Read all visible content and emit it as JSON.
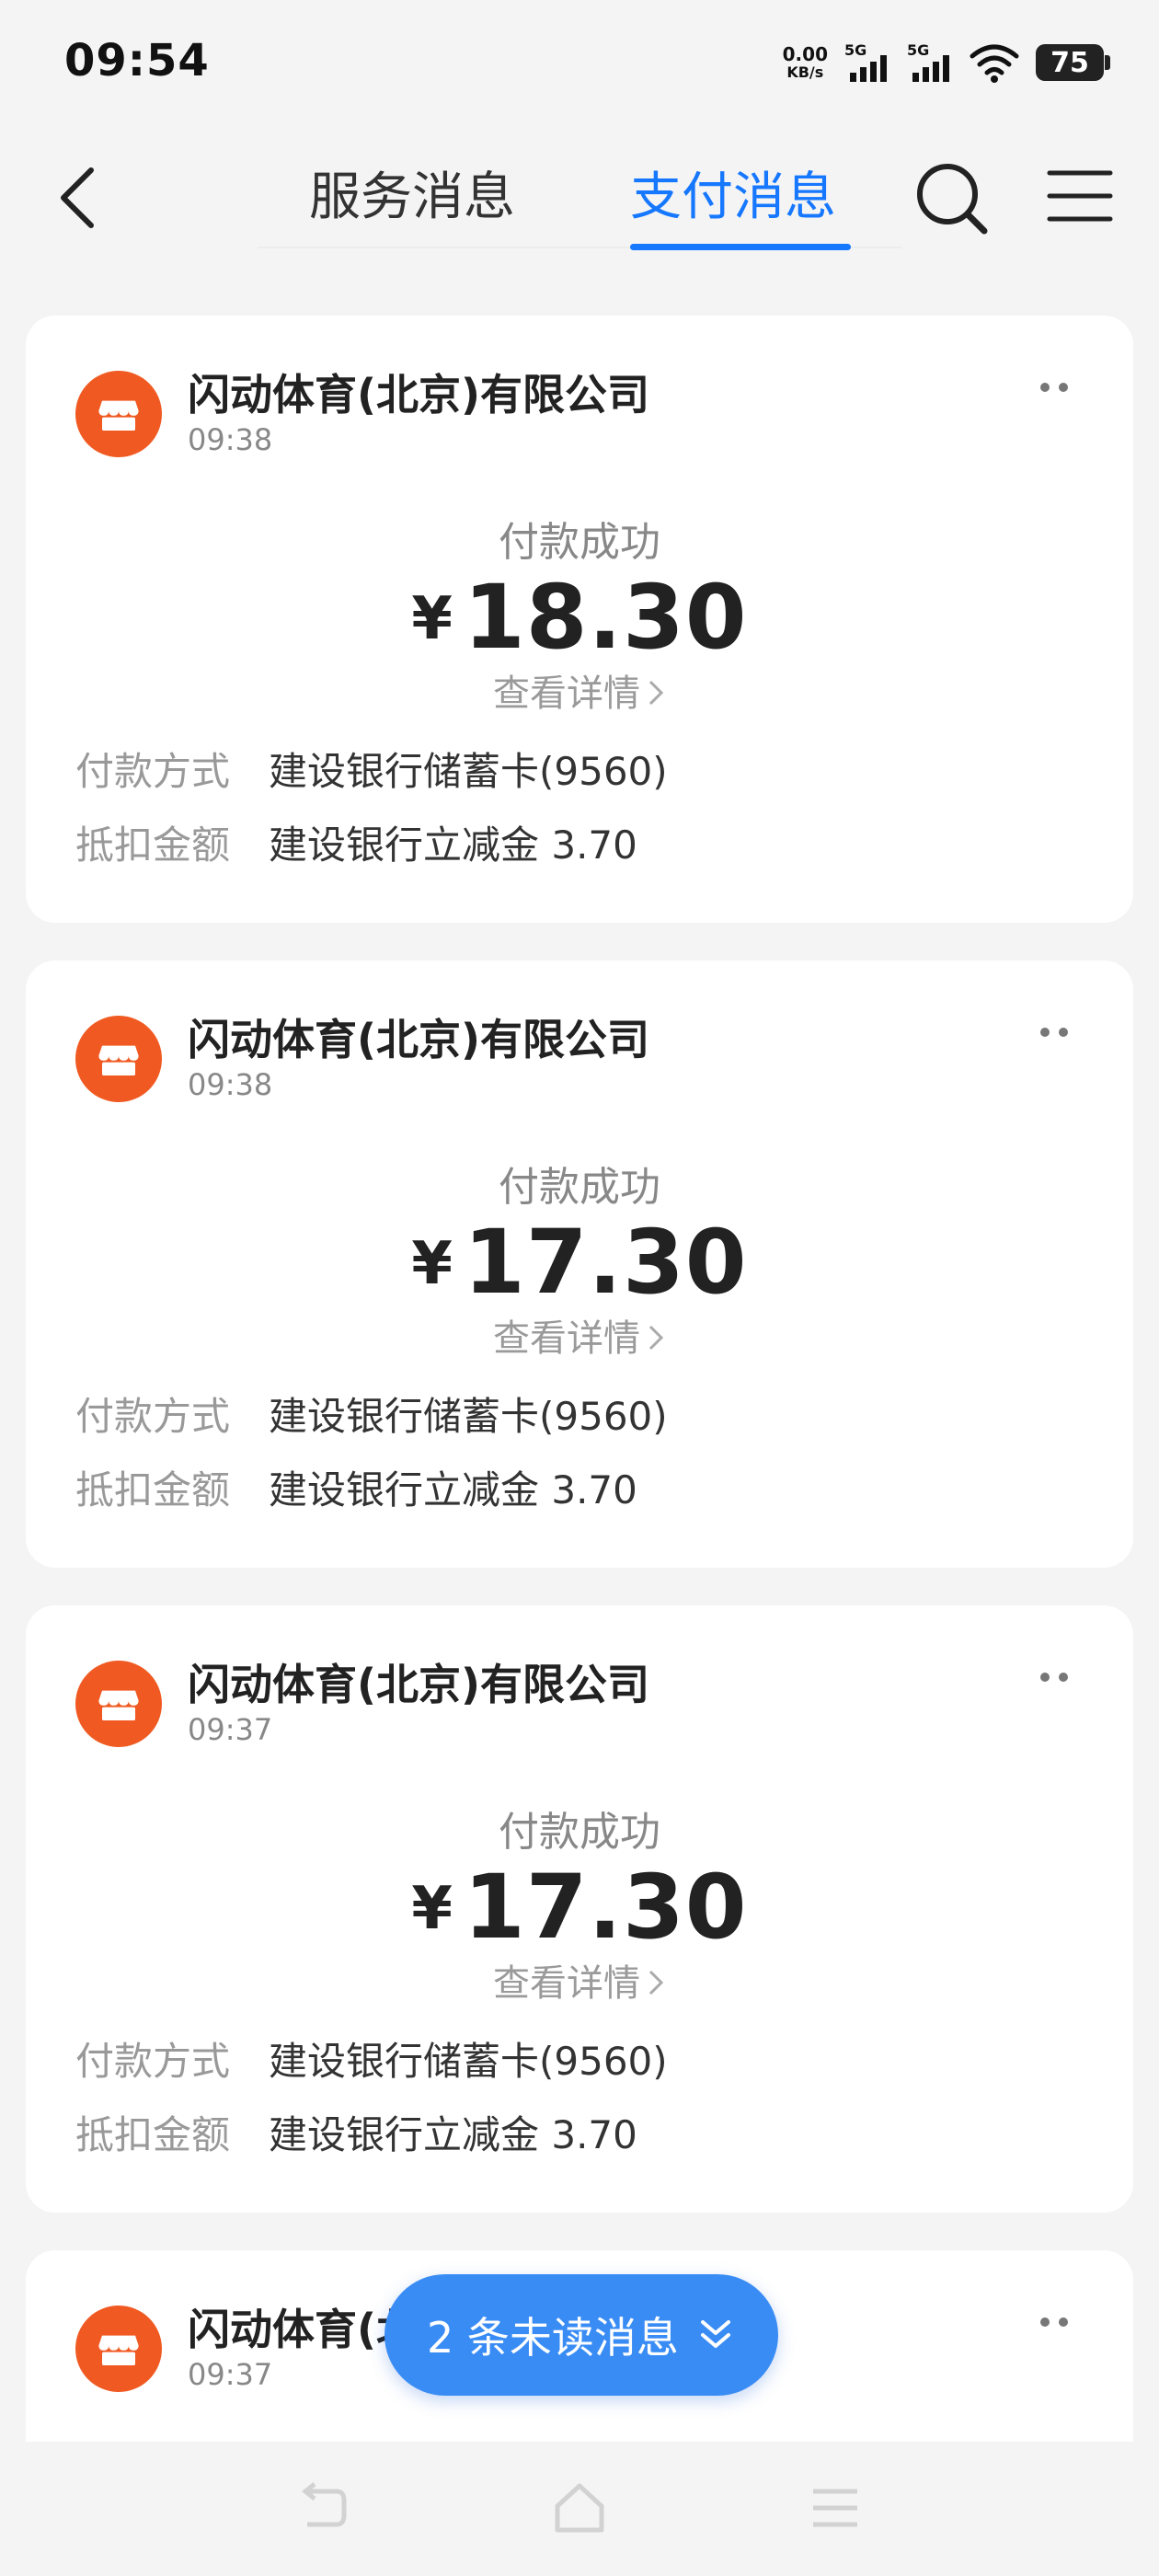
{
  "status_bar": {
    "time": "09:54",
    "net_speed_value": "0.00",
    "net_speed_unit": "KB/s",
    "signal_1": "5G",
    "signal_2": "5G",
    "battery": "75"
  },
  "nav": {
    "tabs": [
      {
        "label": "服务消息",
        "active": false
      },
      {
        "label": "支付消息",
        "active": true
      }
    ],
    "icons": [
      "back-icon",
      "search-icon",
      "menu-icon"
    ],
    "accent_color": "#1677ff"
  },
  "messages": [
    {
      "merchant": "闪动体育(北京)有限公司",
      "time": "09:38",
      "status": "付款成功",
      "currency": "¥",
      "amount": "18.30",
      "detail_label": "查看详情",
      "method_label": "付款方式",
      "method_value": "建设银行储蓄卡(9560)",
      "discount_label": "抵扣金额",
      "discount_value": "建设银行立减金 3.70"
    },
    {
      "merchant": "闪动体育(北京)有限公司",
      "time": "09:38",
      "status": "付款成功",
      "currency": "¥",
      "amount": "17.30",
      "detail_label": "查看详情",
      "method_label": "付款方式",
      "method_value": "建设银行储蓄卡(9560)",
      "discount_label": "抵扣金额",
      "discount_value": "建设银行立减金 3.70"
    },
    {
      "merchant": "闪动体育(北京)有限公司",
      "time": "09:37",
      "status": "付款成功",
      "currency": "¥",
      "amount": "17.30",
      "detail_label": "查看详情",
      "method_label": "付款方式",
      "method_value": "建设银行储蓄卡(9560)",
      "discount_label": "抵扣金额",
      "discount_value": "建设银行立减金 3.70"
    },
    {
      "merchant": "闪动体育(北京)有限公司",
      "time": "09:37"
    }
  ],
  "unread_button": {
    "label": "2 条未读消息",
    "color": "#3a8cf5"
  },
  "merchant_logo_color": "#f05a22",
  "bottom_nav": {
    "icons": [
      "back-gesture-icon",
      "home-icon",
      "recents-icon"
    ]
  }
}
